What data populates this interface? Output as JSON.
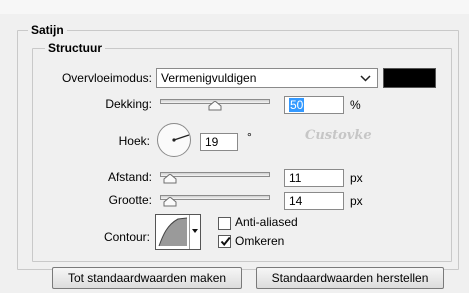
{
  "colors": {
    "shadow_swatch": "#000000",
    "selection": "#3399ff"
  },
  "panel": {
    "title": "Satijn"
  },
  "structure": {
    "title": "Structuur",
    "blend_mode": {
      "label": "Overvloeimodus:",
      "value": "Vermenigvuldigen"
    },
    "opacity": {
      "label": "Dekking:",
      "value": "50",
      "unit": "%",
      "level_percent": 50
    },
    "angle": {
      "label": "Hoek:",
      "value": "19",
      "unit": "°"
    },
    "distance": {
      "label": "Afstand:",
      "value": "11",
      "unit": "px"
    },
    "size": {
      "label": "Grootte:",
      "value": "14",
      "unit": "px"
    },
    "contour": {
      "label": "Contour:"
    },
    "anti_aliased": {
      "label": "Anti-aliased",
      "checked": false
    },
    "invert": {
      "label": "Omkeren",
      "checked": true
    }
  },
  "watermark": "Custovke",
  "buttons": {
    "make_default": "Tot standaardwaarden maken",
    "reset_default": "Standaardwaarden herstellen"
  }
}
